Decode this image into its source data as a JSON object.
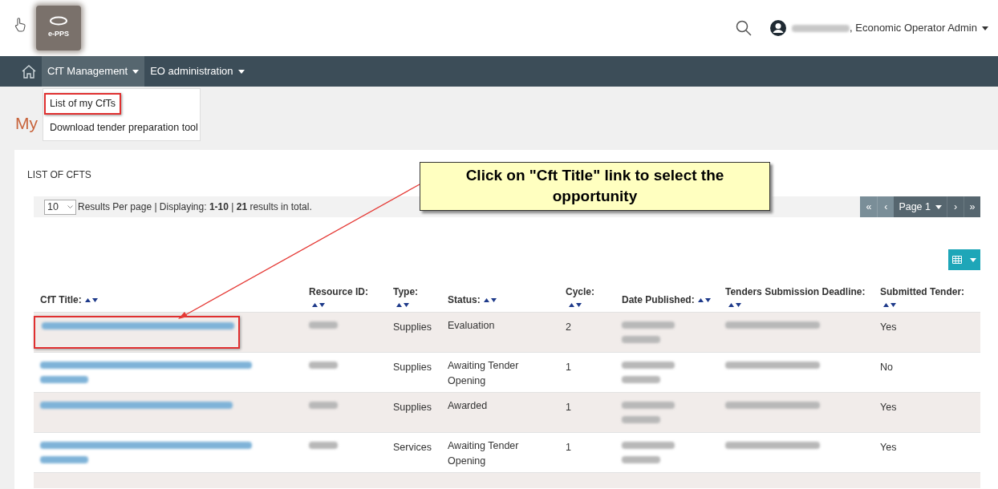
{
  "header": {
    "logo_text": "e-PPS",
    "user_role": ", Economic Operator Admin"
  },
  "nav": {
    "items": [
      {
        "label": "CfT Management",
        "selected": true
      },
      {
        "label": "EO administration",
        "selected": false
      }
    ]
  },
  "dropdown": {
    "items": [
      {
        "label": "List of my CfTs",
        "highlighted": true
      },
      {
        "label": "Download tender preparation tool",
        "highlighted": false
      }
    ]
  },
  "page_title": "My",
  "card": {
    "title": "LIST OF CFTS",
    "per_page": "10",
    "summary": "Results Per page | Displaying: **1-10** | **21** results in total.",
    "pagination": {
      "first": "«",
      "prev": "‹",
      "page": "Page 1",
      "next": "›",
      "last": "»"
    }
  },
  "table": {
    "columns": [
      {
        "label": "CfT Title:",
        "stacked": false
      },
      {
        "label": "Resource ID:",
        "stacked": true
      },
      {
        "label": "Type:",
        "stacked": true
      },
      {
        "label": "Status:",
        "stacked": false
      },
      {
        "label": "Cycle:",
        "stacked": true
      },
      {
        "label": "Date Published:",
        "stacked": false
      },
      {
        "label": "Tenders Submission Deadline:",
        "stacked": true
      },
      {
        "label": "Submitted Tender:",
        "stacked": true
      }
    ],
    "rows": [
      {
        "title_wraps": false,
        "highlighted": true,
        "type": "Supplies",
        "status": "Evaluation",
        "cycle": "2",
        "submitted": "Yes"
      },
      {
        "title_wraps": true,
        "highlighted": false,
        "type": "Supplies",
        "status": "Awaiting Tender Opening",
        "cycle": "1",
        "submitted": "No"
      },
      {
        "title_wraps": false,
        "highlighted": false,
        "type": "Supplies",
        "status": "Awarded",
        "cycle": "1",
        "submitted": "Yes"
      },
      {
        "title_wraps": true,
        "highlighted": false,
        "type": "Services",
        "status": "Awaiting Tender Opening",
        "cycle": "1",
        "submitted": "Yes"
      }
    ]
  },
  "callout": {
    "text": "Click on \"Cft Title\" link to select the opportunity"
  }
}
